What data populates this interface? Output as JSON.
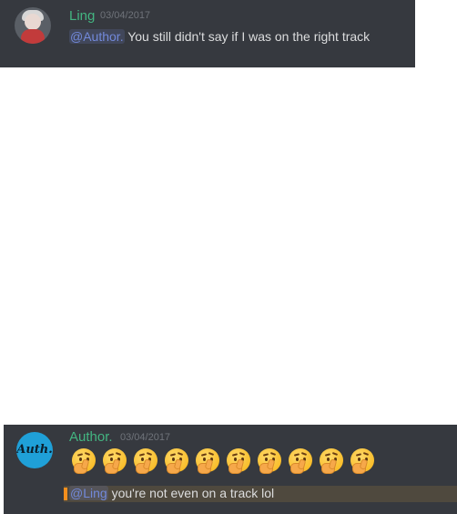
{
  "messages": [
    {
      "author": "Ling",
      "timestamp": "03/04/2017",
      "mention": "@Author.",
      "text": " You still didn't say if I was on the right track",
      "name_color": "#43b581"
    },
    {
      "author": "Author.",
      "timestamp": "03/04/2017",
      "reactions_emoji": "thinking-face-icon",
      "emoji_count": 10,
      "mention": "@Ling",
      "text": " you're not even on a track lol",
      "name_color": "#43b581",
      "quote_bar_color": "#f48f1d"
    }
  ],
  "avatars": {
    "author_logo_text": "Auth."
  },
  "colors": {
    "panel_bg": "#36393f",
    "mention": "#7289da"
  }
}
